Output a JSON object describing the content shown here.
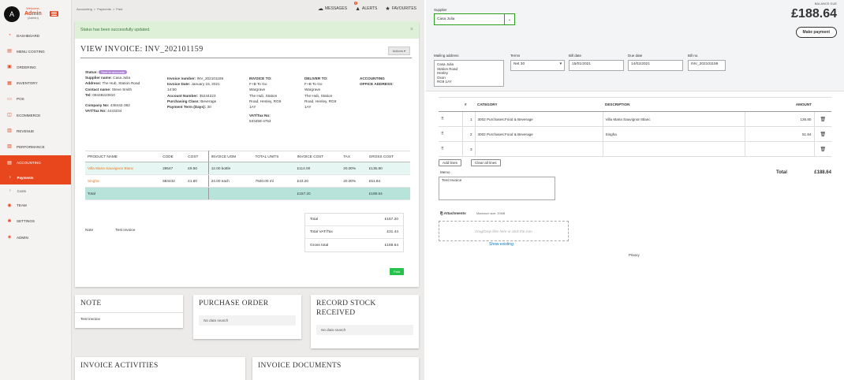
{
  "sidebar": {
    "avatar_letter": "A",
    "welcome": "Welcome,",
    "user_name": "Admin",
    "user_role": "(Admin)",
    "items": [
      {
        "label": "DASHBOARD",
        "icon": "dashboard-icon",
        "glyph": "◔"
      },
      {
        "label": "MENU COSTING",
        "icon": "menu-icon",
        "glyph": "▤"
      },
      {
        "label": "ORDERING",
        "icon": "ordering-icon",
        "glyph": "▣"
      },
      {
        "label": "INVENTORY",
        "icon": "inventory-icon",
        "glyph": "▦"
      },
      {
        "label": "POS",
        "icon": "pos-icon",
        "glyph": "▭"
      },
      {
        "label": "ECOMMERCE",
        "icon": "cart-icon",
        "glyph": "◫"
      },
      {
        "label": "REVENUE",
        "icon": "revenue-icon",
        "glyph": "▥"
      },
      {
        "label": "PERFORMANCE",
        "icon": "chart-icon",
        "glyph": "▨"
      },
      {
        "label": "ACCOUNTING",
        "icon": "accounting-icon",
        "glyph": "▤"
      }
    ],
    "sub_items": [
      {
        "label": "Payments"
      },
      {
        "label": "Costs"
      }
    ],
    "items_after": [
      {
        "label": "TEAM",
        "icon": "team-icon",
        "glyph": "◉"
      },
      {
        "label": "SETTINGS",
        "icon": "gear-icon",
        "glyph": "✱"
      },
      {
        "label": "ADMIN",
        "icon": "admin-icon",
        "glyph": "◈"
      }
    ]
  },
  "breadcrumb": [
    "Accounting",
    ">",
    "Payments",
    ">",
    "Paid"
  ],
  "top_actions": {
    "messages": "MESSAGES",
    "alerts": "ALERTS",
    "alerts_count": "6",
    "favourites": "FAVOURITES"
  },
  "success_message": "Status has been successfully updated.",
  "view_title": "VIEW INVOICE: INV_202101159",
  "actions_label": "Actions ▾",
  "invoice": {
    "status_label": "Status:",
    "status_value": "Sent to accounts",
    "col1": [
      {
        "k": "Supplier name:",
        "v": " Casa Julia"
      },
      {
        "k": "Address:",
        "v": " The Hub, Station Road"
      },
      {
        "k": "Contact name:",
        "v": " Steve Smith"
      },
      {
        "k": "Tel:",
        "v": " 08448223910"
      }
    ],
    "company_no": {
      "k": "Company No:",
      "v": " 438442-382"
    },
    "vat_no": {
      "k": "VAT/Tax No:",
      "v": " 4443234"
    },
    "col2": [
      {
        "k": "Invoice number:",
        "v": " INV_202101159"
      },
      {
        "k": "Invoice Date:",
        "v": " January 15, 2021"
      },
      {
        "k": "",
        "v": "14:50"
      },
      {
        "k": "Account Number:",
        "v": " 35244223"
      },
      {
        "k": "Purchasing Class:",
        "v": " Beverage"
      },
      {
        "k": "Payment Term (Days):",
        "v": " 30"
      }
    ],
    "invoice_to_title": "INVOICE TO:",
    "invoice_to": [
      "F+B To Go",
      "Wargrave",
      "The Hub, Station",
      "Road, Henley, RG9",
      "1AY"
    ],
    "vat_title": "VAT/Tax No:",
    "vat_value": "533458-4754",
    "deliver_to_title": "DELIVER TO:",
    "deliver_to": [
      "F+B To Go",
      "Wargrave",
      "The Hub, Station",
      "Road, Henley, RG9",
      "1AY"
    ],
    "accounting_title_1": "ACCOUNTING",
    "accounting_title_2": "OFFICE ADDRESS:"
  },
  "products": {
    "headers": [
      "PRODUCT NAME",
      "CODE",
      "COST",
      "INVOICE UOM",
      "TOTAL UNITS",
      "INVOICE COST",
      "TAX",
      "GROSS COST"
    ],
    "rows": [
      [
        "Villa Maria Sauvignon Blanc",
        "29547",
        "£9.50",
        "12.00 bottle",
        "",
        "£114.00",
        "20.00%",
        "£136.80"
      ],
      [
        "Singha",
        "583432",
        "£1.80",
        "24.00 each",
        "7920.00 ml",
        "£43.20",
        "20.00%",
        "£51.84"
      ]
    ],
    "total_label": "Total",
    "total_invoice_cost": "£157.20",
    "total_gross": "£188.64"
  },
  "note": {
    "label": "Note",
    "value": "Test invoice"
  },
  "totals": [
    {
      "k": "Total",
      "v": "£157.20"
    },
    {
      "k": "Total VAT/Tax",
      "v": "£31.44"
    },
    {
      "k": "Gross total",
      "v": "£188.64"
    }
  ],
  "paid_label": "Paid",
  "cards": {
    "note_title": "NOTE",
    "note_body": "Test invoice",
    "po_title": "PURCHASE ORDER",
    "po_nodata": "No data search",
    "rsr_title_1": "RECORD STOCK",
    "rsr_title_2": "RECEIVED",
    "rsr_nodata": "No data search",
    "activities_title": "INVOICE ACTIVITIES",
    "documents_title": "INVOICE DOCUMENTS"
  },
  "bill": {
    "supplier_label": "Supplier",
    "supplier_value": "Casa Julia",
    "balance_label": "BALANCE DUE",
    "balance": "£188.64",
    "make_payment": "Make payment",
    "mailing_label": "Mailing address",
    "mailing_lines": [
      "Casa Julia",
      "Station Road",
      "Henley",
      "Oxon",
      "RG9 1AY"
    ],
    "terms_label": "Terms",
    "terms_value": "Net 30",
    "bill_date_label": "Bill date",
    "bill_date": "15/01/2021",
    "due_date_label": "Due date",
    "due_date": "14/02/2021",
    "bill_no_label": "Bill no.",
    "bill_no": "INV_202101159",
    "line_headers": [
      "",
      "#",
      "CATEGORY",
      "DESCRIPTION",
      "AMOUNT",
      ""
    ],
    "lines": [
      {
        "n": "1",
        "category": "3002 Purchases:Food & Beverage",
        "description": "Villa Maria Sauvignon Blanc",
        "amount": "136.80"
      },
      {
        "n": "2",
        "category": "3002 Purchases:Food & Beverage",
        "description": "Singha",
        "amount": "51.84"
      },
      {
        "n": "3",
        "category": "",
        "description": "",
        "amount": ""
      }
    ],
    "add_lines": "Add lines",
    "clear_lines": "Clear all lines",
    "total_label": "Total",
    "total_value": "£188.64",
    "memo_label": "Memo",
    "memo_value": "Test Invoice",
    "attachments_label": "Attachments",
    "attach_max": "Maximum size: 20MB",
    "drop_text": "Drag/Drop files here or click the icon",
    "show_existing": "Show existing",
    "privacy": "Privacy"
  }
}
